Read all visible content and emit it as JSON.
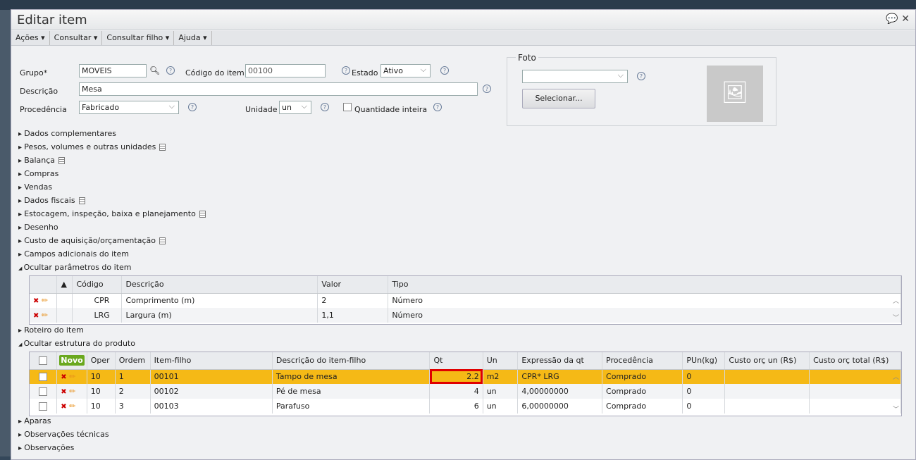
{
  "window": {
    "title": "Editar item"
  },
  "menu": [
    "Ações",
    "Consultar",
    "Consultar filho",
    "Ajuda"
  ],
  "form": {
    "grupo_label": "Grupo*",
    "grupo": "MOVEIS",
    "codigo_label": "Código do item",
    "codigo": "00100",
    "estado_label": "Estado",
    "estado": "Ativo",
    "descricao_label": "Descrição",
    "descricao": "Mesa",
    "procedencia_label": "Procedência",
    "procedencia": "Fabricado",
    "unidade_label": "Unidade",
    "unidade": "un",
    "qtd_inteira_label": "Quantidade inteira"
  },
  "foto": {
    "label": "Foto",
    "select_value": "",
    "button": "Selecionar..."
  },
  "sections_top": [
    "Dados complementares",
    "Pesos, volumes e outras unidades",
    "Balança",
    "Compras",
    "Vendas",
    "Dados fiscais",
    "Estocagem, inspeção, baixa e planejamento",
    "Desenho",
    "Custo de aquisição/orçamentação",
    "Campos adicionais do item",
    "Ocultar parâmetros do item"
  ],
  "params": {
    "headers": [
      "Código",
      "Descrição",
      "Valor",
      "Tipo"
    ],
    "rows": [
      [
        "CPR",
        "Comprimento (m)",
        "2",
        "Número"
      ],
      [
        "LRG",
        "Largura (m)",
        "1,1",
        "Número"
      ]
    ]
  },
  "section_roteiro": "Roteiro do item",
  "section_estrutura": "Ocultar estrutura do produto",
  "estrutura": {
    "novo": "Novo",
    "headers": [
      "Oper",
      "Ordem",
      "Item-filho",
      "Descrição do item-filho",
      "Qt",
      "Un",
      "Expressão da qt",
      "Procedência",
      "PUn(kg)",
      "Custo orç un (R$)",
      "Custo orç total (R$)"
    ],
    "rows": [
      [
        "10",
        "1",
        "00101",
        "Tampo de mesa",
        "2.2",
        "m2",
        "CPR* LRG",
        "Comprado",
        "0",
        "",
        ""
      ],
      [
        "10",
        "2",
        "00102",
        "Pé de mesa",
        "4",
        "un",
        "4,00000000",
        "Comprado",
        "0",
        "",
        ""
      ],
      [
        "10",
        "3",
        "00103",
        "Parafuso",
        "6",
        "un",
        "6,00000000",
        "Comprado",
        "0",
        "",
        ""
      ]
    ]
  },
  "sections_bottom": [
    "Aparas",
    "Observações técnicas",
    "Observações"
  ],
  "colors": {
    "highlight": "#f5b916",
    "novo": "#6aa81e",
    "qt_outline": "#e00000"
  }
}
